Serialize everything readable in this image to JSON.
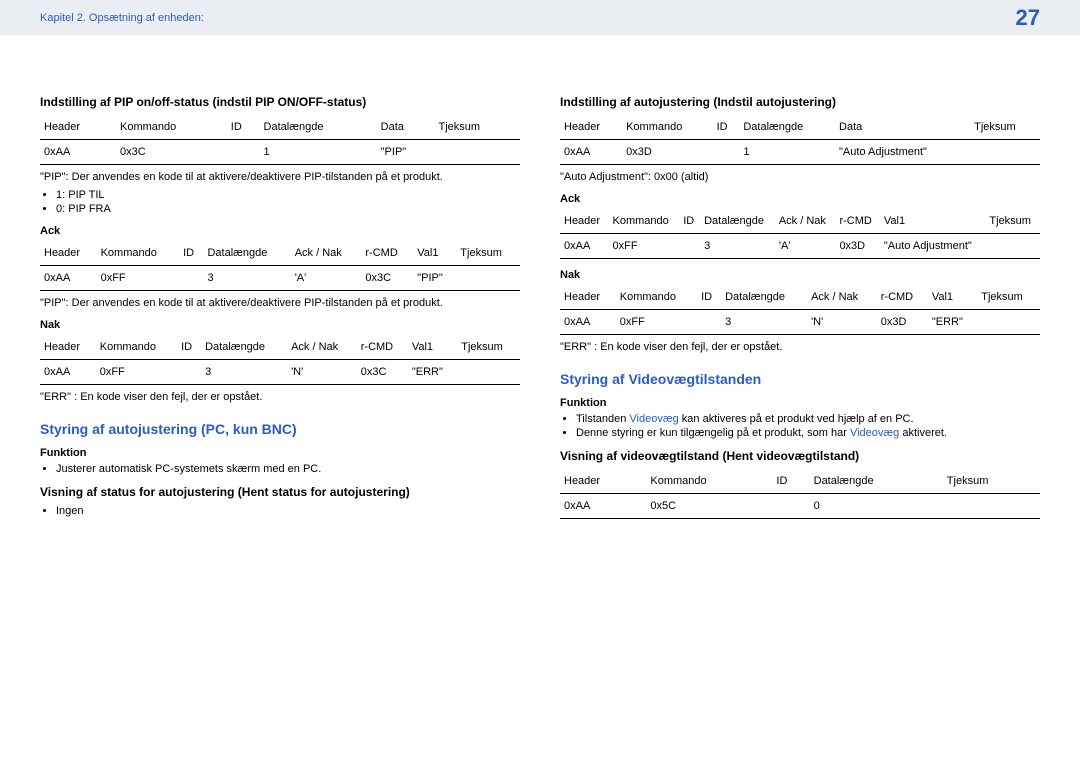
{
  "header": {
    "chapter": "Kapitel 2. Opsætning af enheden:",
    "page_number": "27"
  },
  "left": {
    "s1": {
      "title": "Indstilling af PIP on/off-status (indstil PIP ON/OFF-status)",
      "table1": {
        "headers": [
          "Header",
          "Kommando",
          "ID",
          "Datalængde",
          "Data",
          "Tjeksum"
        ],
        "row": [
          "0xAA",
          "0x3C",
          "",
          "1",
          "\"PIP\"",
          ""
        ]
      },
      "desc": "\"PIP\": Der anvendes en kode til at aktivere/deaktivere PIP-tilstanden på et produkt.",
      "bullets": [
        "1: PIP TIL",
        "0: PIP FRA"
      ],
      "ack_label": "Ack",
      "ack_table": {
        "headers": [
          "Header",
          "Kommando",
          "ID",
          "Datalængde",
          "Ack / Nak",
          "r-CMD",
          "Val1",
          "Tjeksum"
        ],
        "row": [
          "0xAA",
          "0xFF",
          "",
          "3",
          "'A'",
          "0x3C",
          "\"PIP\"",
          ""
        ]
      },
      "desc2": "\"PIP\": Der anvendes en kode til at aktivere/deaktivere PIP-tilstanden på et produkt.",
      "nak_label": "Nak",
      "nak_table": {
        "headers": [
          "Header",
          "Kommando",
          "ID",
          "Datalængde",
          "Ack / Nak",
          "r-CMD",
          "Val1",
          "Tjeksum"
        ],
        "row": [
          "0xAA",
          "0xFF",
          "",
          "3",
          "'N'",
          "0x3C",
          "\"ERR\"",
          ""
        ]
      },
      "err_desc": "\"ERR\" : En kode viser den fejl, der er opstået."
    },
    "s2": {
      "title": "Styring af autojustering (PC, kun BNC)",
      "funktion_label": "Funktion",
      "funktion_bullet": "Justerer automatisk PC-systemets skærm med en PC.",
      "view_label": "Visning af status for autojustering (Hent status for autojustering)",
      "view_bullet": "Ingen"
    }
  },
  "right": {
    "s3": {
      "title": "Indstilling af autojustering (Indstil autojustering)",
      "table1": {
        "headers": [
          "Header",
          "Kommando",
          "ID",
          "Datalængde",
          "Data",
          "Tjeksum"
        ],
        "row": [
          "0xAA",
          "0x3D",
          "",
          "1",
          "\"Auto Adjustment\"",
          ""
        ]
      },
      "desc": "\"Auto Adjustment\": 0x00 (altid)",
      "ack_label": "Ack",
      "ack_table": {
        "headers": [
          "Header",
          "Kommando",
          "ID",
          "Datalængde",
          "Ack / Nak",
          "r-CMD",
          "Val1",
          "Tjeksum"
        ],
        "row": [
          "0xAA",
          "0xFF",
          "",
          "3",
          "'A'",
          "0x3D",
          "\"Auto Adjustment\"",
          ""
        ]
      },
      "nak_label": "Nak",
      "nak_table": {
        "headers": [
          "Header",
          "Kommando",
          "ID",
          "Datalængde",
          "Ack / Nak",
          "r-CMD",
          "Val1",
          "Tjeksum"
        ],
        "row": [
          "0xAA",
          "0xFF",
          "",
          "3",
          "'N'",
          "0x3D",
          "\"ERR\"",
          ""
        ]
      },
      "err_desc": "\"ERR\" : En kode viser den fejl, der er opstået."
    },
    "s4": {
      "title": "Styring af Videovægtilstanden",
      "funktion_label": "Funktion",
      "bullets": [
        {
          "text": "Tilstanden ",
          "link": "Videovæg",
          "rest": " kan aktiveres på et produkt ved hjælp af en PC."
        },
        {
          "text": "Denne styring er kun tilgængelig på et produkt, som har ",
          "link": "Videovæg",
          "rest": " aktiveret."
        }
      ],
      "view_label": "Visning af videovægtilstand (Hent videovægtilstand)",
      "table": {
        "headers": [
          "Header",
          "Kommando",
          "ID",
          "Datalængde",
          "Tjeksum"
        ],
        "row": [
          "0xAA",
          "0x5C",
          "",
          "0",
          ""
        ]
      }
    }
  }
}
